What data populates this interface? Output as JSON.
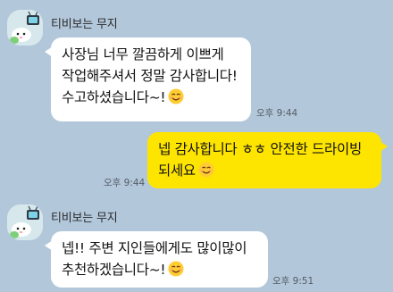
{
  "messages": [
    {
      "sender": "티비보는 무지",
      "lines": [
        "사장님 너무 깔끔하게 이쁘게",
        "작업해주셔서 정말 감사합니다!",
        "수고하셨습니다~!"
      ],
      "time": "오후 9:44",
      "emoji": "smiling-face"
    },
    {
      "lines": [
        "넵 감사합니다 ㅎㅎ 안전한 드라이빙",
        "되세요"
      ],
      "time": "오후 9:44",
      "emoji": "smiling-face"
    },
    {
      "sender": "티비보는 무지",
      "lines": [
        "넵!! 주변 지인들에게도 많이많이",
        "추천하겠습니다~!"
      ],
      "time": "오후 9:51",
      "emoji": "smiling-face"
    }
  ],
  "colors": {
    "background": "#b2c7da",
    "incoming_bubble": "#ffffff",
    "outgoing_bubble": "#fee500"
  }
}
